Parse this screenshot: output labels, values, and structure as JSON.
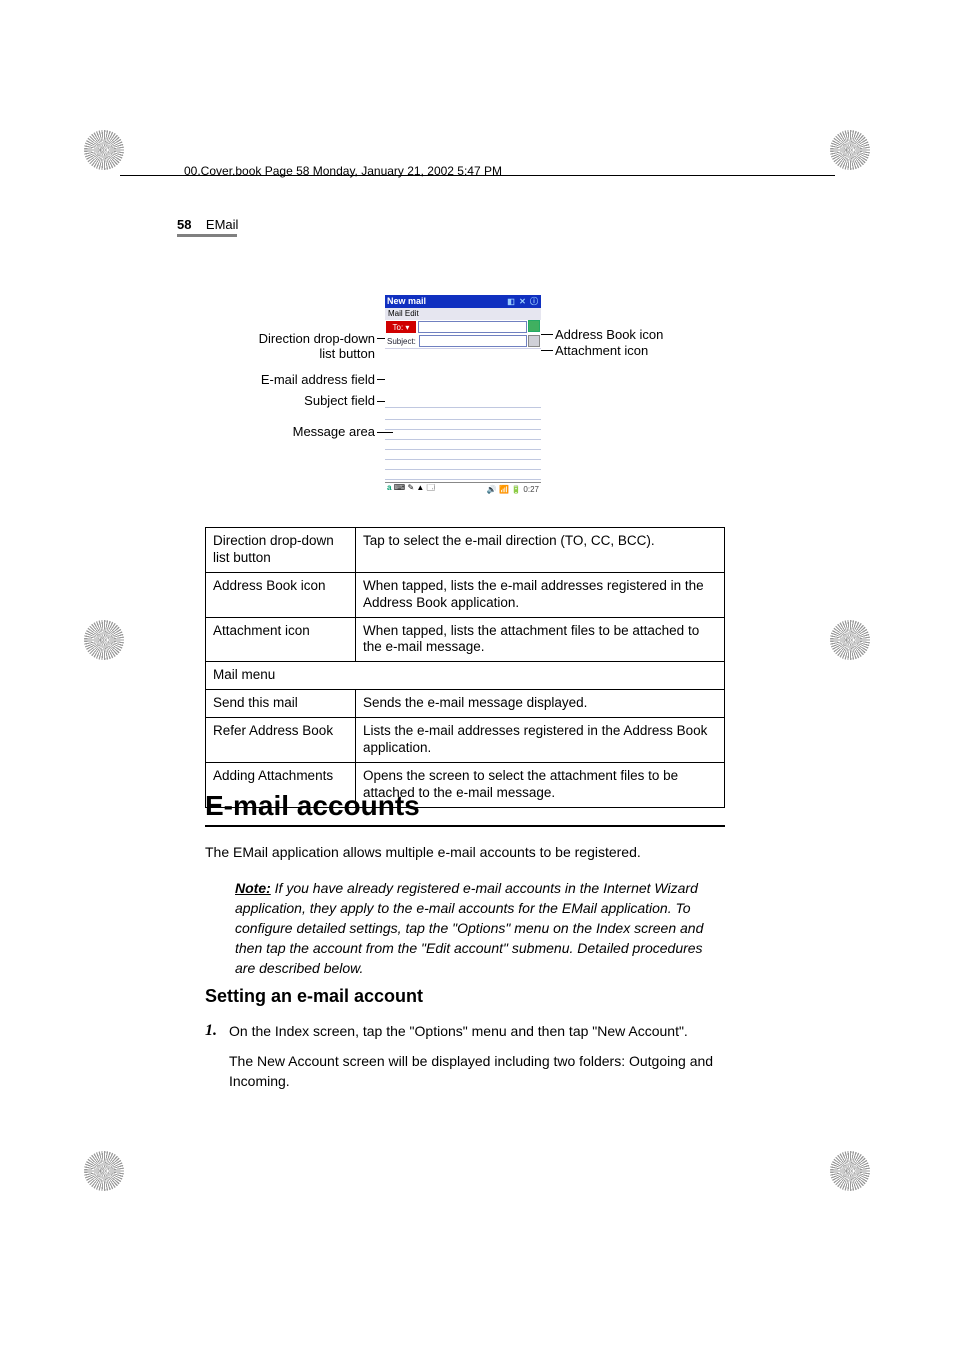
{
  "book_header": "00.Cover.book  Page 58  Monday, January 21, 2002  5:47 PM",
  "page_number": "58",
  "page_header_label": "EMail",
  "device": {
    "title": "New mail",
    "menu": "Mail    Edit",
    "to_button": "To:  ▾",
    "subject_label": "Subject:",
    "taskbar_left": "a",
    "taskbar_right": "0:27"
  },
  "callouts": {
    "direction_dropdown": "Direction drop-down\nlist button",
    "email_address_field": "E-mail address field",
    "subject_field": "Subject field",
    "message_area": "Message area",
    "address_book_icon": "Address Book icon",
    "attachment_icon": "Attachment icon"
  },
  "definitions": [
    {
      "term": "Direction drop-down list button",
      "desc": "Tap to select the e-mail direction (TO, CC, BCC)."
    },
    {
      "term": "Address Book icon",
      "desc": "When tapped, lists the e-mail addresses registered in the Address Book application."
    },
    {
      "term": "Attachment icon",
      "desc": "When tapped, lists the attachment files to be attached to the e-mail message."
    },
    {
      "term": "Mail menu",
      "span": true
    },
    {
      "term": "Send this mail",
      "desc": "Sends the e-mail message displayed."
    },
    {
      "term": "Refer Address Book",
      "desc": "Lists the e-mail addresses registered in the Address Book application."
    },
    {
      "term": "Adding Attachments",
      "desc": "Opens the screen to select the attachment files to be attached to the e-mail message."
    }
  ],
  "headings": {
    "email_accounts": "E-mail accounts",
    "setting_account": "Setting an e-mail account"
  },
  "body": {
    "intro": "The EMail application allows multiple e-mail accounts to be registered.",
    "note_label": "Note:",
    "note_text": "If you have already registered e-mail accounts in the Internet Wizard application, they apply to the e-mail accounts for the EMail application. To configure detailed settings, tap the \"Options\" menu on the Index screen and then tap the account from the \"Edit account\" submenu. Detailed procedures are described below.",
    "step_number": "1.",
    "step_1a": "On the Index screen, tap the \"Options\" menu and then tap \"New Account\".",
    "step_1b": "The New Account screen will be displayed including two folders: Outgoing and Incoming."
  }
}
